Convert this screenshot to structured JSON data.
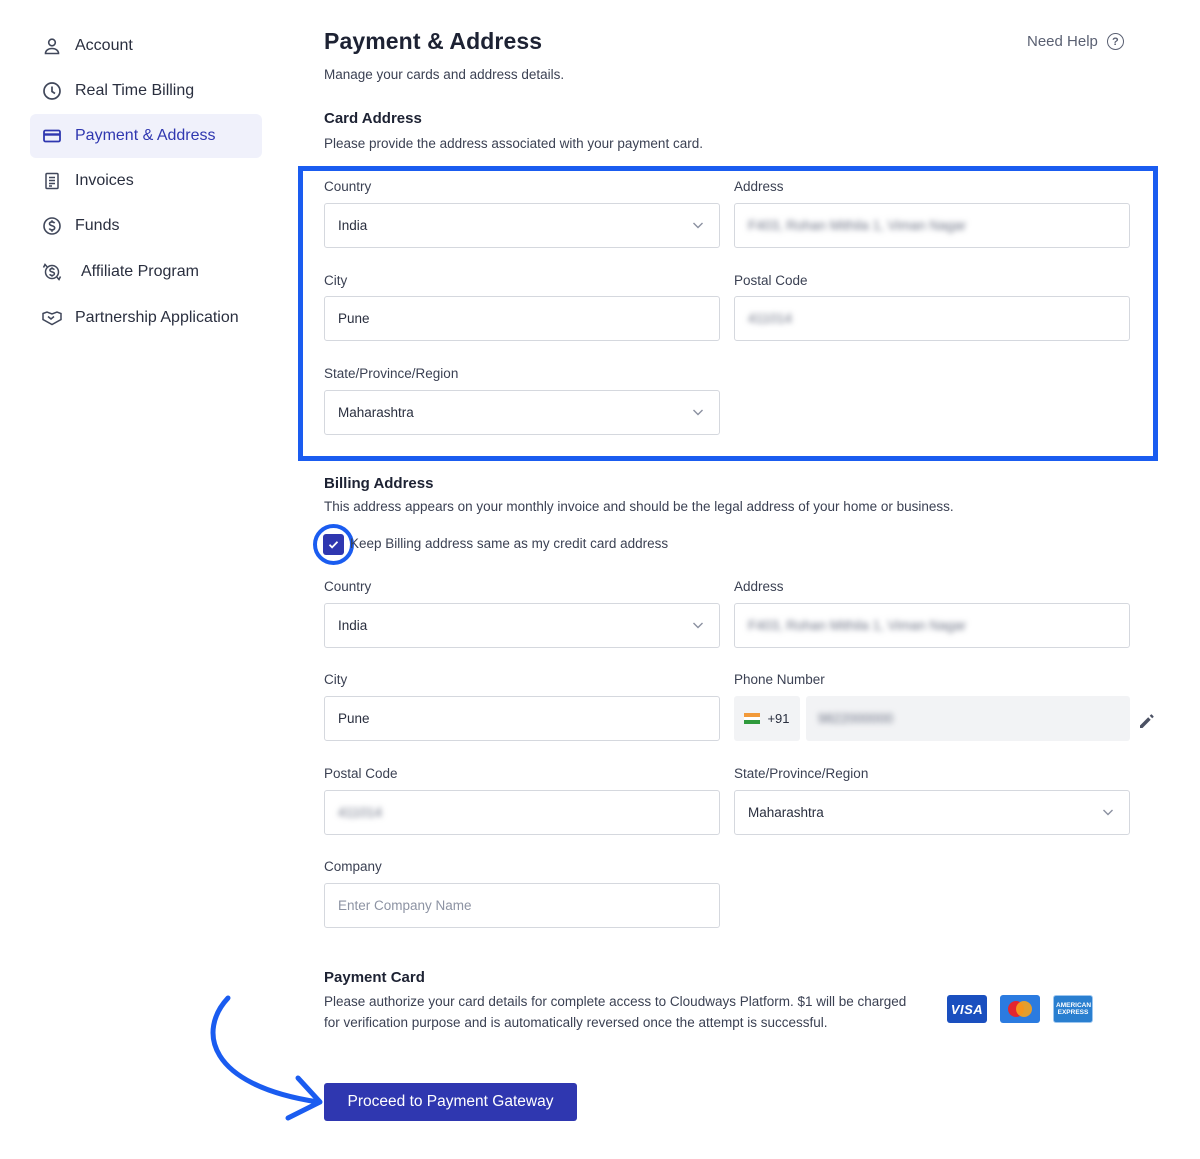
{
  "sidebar": {
    "items": [
      {
        "label": "Account",
        "icon": "user-icon",
        "active": false
      },
      {
        "label": "Real Time Billing",
        "icon": "clock-icon",
        "active": false
      },
      {
        "label": "Payment & Address",
        "icon": "credit-card-icon",
        "active": true
      },
      {
        "label": "Invoices",
        "icon": "invoice-icon",
        "active": false
      },
      {
        "label": "Funds",
        "icon": "dollar-icon",
        "active": false
      },
      {
        "label": "Affiliate Program",
        "icon": "affiliate-icon",
        "active": false
      },
      {
        "label": "Partnership Application",
        "icon": "handshake-icon",
        "active": false
      }
    ]
  },
  "header": {
    "title": "Payment & Address",
    "subtitle": "Manage your cards and address details.",
    "help_label": "Need Help",
    "help_icon": "question-circle-icon"
  },
  "card_address": {
    "title": "Card Address",
    "description": "Please provide the address associated with your payment card.",
    "country_label": "Country",
    "country_value": "India",
    "address_label": "Address",
    "address_value": "F403, Rohan Mithila 1, Viman Nagar",
    "city_label": "City",
    "city_value": "Pune",
    "postal_label": "Postal Code",
    "postal_value": "411014",
    "state_label": "State/Province/Region",
    "state_value": "Maharashtra"
  },
  "billing_address": {
    "title": "Billing Address",
    "description": "This address appears on your monthly invoice and should be the legal address of your home or business.",
    "same_checkbox_label": "Keep Billing address same as my credit card address",
    "same_checked": true,
    "country_label": "Country",
    "country_value": "India",
    "address_label": "Address",
    "address_value": "F403, Rohan Mithila 1, Viman Nagar",
    "city_label": "City",
    "city_value": "Pune",
    "phone_label": "Phone Number",
    "phone_code": "+91",
    "phone_value": "9822000000",
    "postal_label": "Postal Code",
    "postal_value": "411014",
    "state_label": "State/Province/Region",
    "state_value": "Maharashtra",
    "company_label": "Company",
    "company_placeholder": "Enter Company Name"
  },
  "payment_card": {
    "title": "Payment Card",
    "description": "Please authorize your card details for complete access to Cloudways Platform. $1 will be charged for verification purpose and is automatically reversed once the attempt is successful.",
    "card_visa": "VISA",
    "card_amex": "AMERICAN EXPRESS",
    "button_label": "Proceed to Payment Gateway"
  },
  "colors": {
    "accent": "#2f37b0",
    "highlight": "#1a5cf0"
  }
}
